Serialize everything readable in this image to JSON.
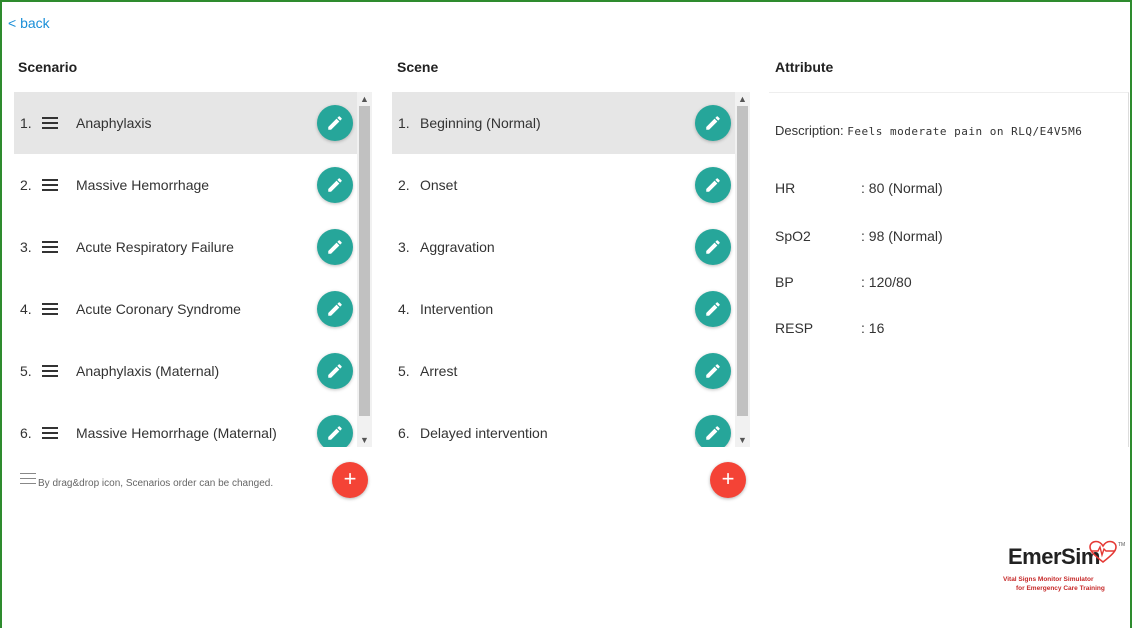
{
  "nav": {
    "back_label": "< back"
  },
  "columns": {
    "scenario_title": "Scenario",
    "scene_title": "Scene",
    "attribute_title": "Attribute"
  },
  "scenarios": [
    {
      "num": "1.",
      "label": "Anaphylaxis"
    },
    {
      "num": "2.",
      "label": "Massive Hemorrhage"
    },
    {
      "num": "3.",
      "label": "Acute Respiratory Failure"
    },
    {
      "num": "4.",
      "label": "Acute Coronary Syndrome"
    },
    {
      "num": "5.",
      "label": "Anaphylaxis (Maternal)"
    },
    {
      "num": "6.",
      "label": "Massive Hemorrhage (Maternal)"
    }
  ],
  "scenes": [
    {
      "num": "1.",
      "label": "Beginning (Normal)"
    },
    {
      "num": "2.",
      "label": "Onset"
    },
    {
      "num": "3.",
      "label": "Aggravation"
    },
    {
      "num": "4.",
      "label": "Intervention"
    },
    {
      "num": "5.",
      "label": "Arrest"
    },
    {
      "num": "6.",
      "label": "Delayed intervention"
    }
  ],
  "hint": "By drag&drop icon, Scenarios order can be changed.",
  "add_label": "+",
  "attribute": {
    "description_label": "Description:",
    "description_value": "Feels moderate pain on RLQ/E4V5M6",
    "rows": [
      {
        "key": "HR",
        "value": ": 80 (Normal)"
      },
      {
        "key": "SpO2",
        "value": ": 98 (Normal)"
      },
      {
        "key": "BP",
        "value": ": 120/80"
      },
      {
        "key": "RESP",
        "value": ": 16"
      }
    ]
  },
  "logo": {
    "name": "EmerSim",
    "tagline1": "Vital Signs Monitor Simulator",
    "tagline2": "for Emergency Care Training",
    "tm": "TM"
  },
  "colors": {
    "accent_teal": "#26a69a",
    "add_red": "#f44336",
    "link_blue": "#1a8fd8",
    "frame_green": "#2e8b2e",
    "selected_row": "#e6e6e6"
  },
  "icons": [
    "pencil-icon",
    "drag-handle-icon",
    "plus-icon",
    "heart-pulse-icon"
  ]
}
